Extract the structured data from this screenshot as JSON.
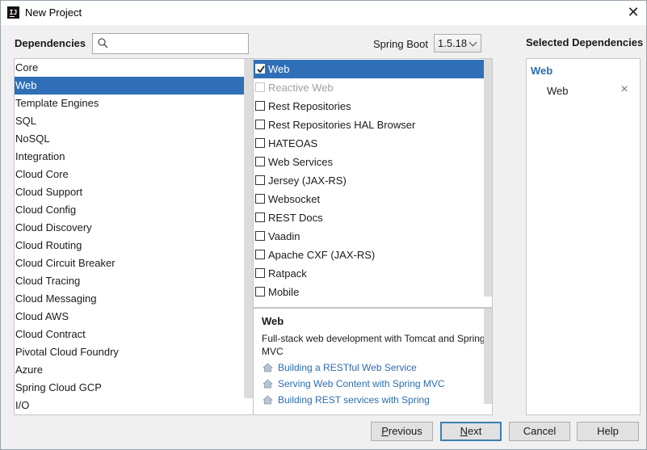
{
  "window": {
    "title": "New Project",
    "icon": "intellij-icon",
    "close_icon": "close-icon"
  },
  "dependencies_label": "Dependencies",
  "search": {
    "value": "",
    "placeholder": ""
  },
  "spring_boot": {
    "label": "Spring Boot",
    "version": "1.5.18"
  },
  "selected_dependencies_label": "Selected Dependencies",
  "categories": [
    "Core",
    "Web",
    "Template Engines",
    "SQL",
    "NoSQL",
    "Integration",
    "Cloud Core",
    "Cloud Support",
    "Cloud Config",
    "Cloud Discovery",
    "Cloud Routing",
    "Cloud Circuit Breaker",
    "Cloud Tracing",
    "Cloud Messaging",
    "Cloud AWS",
    "Cloud Contract",
    "Pivotal Cloud Foundry",
    "Azure",
    "Spring Cloud GCP",
    "I/O"
  ],
  "selected_category_index": 1,
  "dependencies": [
    {
      "label": "Web",
      "checked": true,
      "selected": true,
      "disabled": false
    },
    {
      "label": "Reactive Web",
      "checked": false,
      "selected": false,
      "disabled": true
    },
    {
      "label": "Rest Repositories",
      "checked": false,
      "selected": false,
      "disabled": false
    },
    {
      "label": "Rest Repositories HAL Browser",
      "checked": false,
      "selected": false,
      "disabled": false
    },
    {
      "label": "HATEOAS",
      "checked": false,
      "selected": false,
      "disabled": false
    },
    {
      "label": "Web Services",
      "checked": false,
      "selected": false,
      "disabled": false
    },
    {
      "label": "Jersey (JAX-RS)",
      "checked": false,
      "selected": false,
      "disabled": false
    },
    {
      "label": "Websocket",
      "checked": false,
      "selected": false,
      "disabled": false
    },
    {
      "label": "REST Docs",
      "checked": false,
      "selected": false,
      "disabled": false
    },
    {
      "label": "Vaadin",
      "checked": false,
      "selected": false,
      "disabled": false
    },
    {
      "label": "Apache CXF (JAX-RS)",
      "checked": false,
      "selected": false,
      "disabled": false
    },
    {
      "label": "Ratpack",
      "checked": false,
      "selected": false,
      "disabled": false
    },
    {
      "label": "Mobile",
      "checked": false,
      "selected": false,
      "disabled": false
    }
  ],
  "description": {
    "title": "Web",
    "text": "Full-stack web development with Tomcat and Spring MVC",
    "links": [
      "Building a RESTful Web Service",
      "Serving Web Content with Spring MVC",
      "Building REST services with Spring"
    ],
    "link_icon": "home-icon"
  },
  "selected": {
    "group": "Web",
    "items": [
      "Web"
    ],
    "remove_icon": "remove-icon"
  },
  "buttons": {
    "previous": {
      "mnemonic": "P",
      "rest": "revious"
    },
    "next": {
      "mnemonic": "N",
      "rest": "ext"
    },
    "cancel": "Cancel",
    "help": "Help"
  },
  "colors": {
    "selection": "#2f6fb7",
    "link": "#2b6cb0",
    "window_bg": "#f0f0f0"
  }
}
